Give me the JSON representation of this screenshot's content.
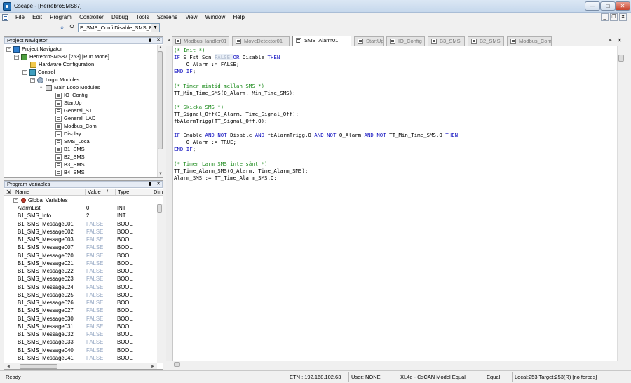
{
  "window": {
    "title": "Cscape - [HerrebroSMS87]",
    "minimize": "—",
    "maximize": "□",
    "close": "✕",
    "mdi_minimize": "_",
    "mdi_restore": "❐",
    "mdi_close": "✕"
  },
  "menu": {
    "items": [
      "File",
      "Edit",
      "Program",
      "Controller",
      "Debug",
      "Tools",
      "Screens",
      "View",
      "Window",
      "Help"
    ]
  },
  "toolbar": {
    "module_select": "E_SMS_Confi Disable_SMS_B1",
    "select_arrow": "▼"
  },
  "navigator": {
    "header": "Project Navigator",
    "pin": "▮",
    "close": "✕",
    "project": "Project Navigator",
    "controller": "HerrebroSMS87 [253] [Run Mode]",
    "hardware": "Hardware Configuration",
    "control": "Control",
    "logic_modules": "Logic Modules",
    "main_loop": "Main Loop Modules",
    "modules": [
      "IO_Config",
      "StartUp",
      "General_ST",
      "General_LAD",
      "Modbus_Com",
      "Display",
      "SMS_Local",
      "B1_SMS",
      "B2_SMS",
      "B3_SMS",
      "B4_SMS"
    ],
    "expand_minus": "−"
  },
  "variables": {
    "header": "Program Variables",
    "col_name": "Name",
    "col_value": "Value",
    "col_type": "Type",
    "col_dim": "Dim.",
    "sort_mark": "/",
    "group": "Global Variables",
    "rows": [
      {
        "name": "AlarmList",
        "value": "0",
        "type": "INT",
        "is_false": false
      },
      {
        "name": "B1_SMS_Info",
        "value": "2",
        "type": "INT",
        "is_false": false
      },
      {
        "name": "B1_SMS_Message001",
        "value": "FALSE",
        "type": "BOOL",
        "is_false": true
      },
      {
        "name": "B1_SMS_Message002",
        "value": "FALSE",
        "type": "BOOL",
        "is_false": true
      },
      {
        "name": "B1_SMS_Message003",
        "value": "FALSE",
        "type": "BOOL",
        "is_false": true
      },
      {
        "name": "B1_SMS_Message007",
        "value": "FALSE",
        "type": "BOOL",
        "is_false": true
      },
      {
        "name": "B1_SMS_Message020",
        "value": "FALSE",
        "type": "BOOL",
        "is_false": true
      },
      {
        "name": "B1_SMS_Message021",
        "value": "FALSE",
        "type": "BOOL",
        "is_false": true
      },
      {
        "name": "B1_SMS_Message022",
        "value": "FALSE",
        "type": "BOOL",
        "is_false": true
      },
      {
        "name": "B1_SMS_Message023",
        "value": "FALSE",
        "type": "BOOL",
        "is_false": true
      },
      {
        "name": "B1_SMS_Message024",
        "value": "FALSE",
        "type": "BOOL",
        "is_false": true
      },
      {
        "name": "B1_SMS_Message025",
        "value": "FALSE",
        "type": "BOOL",
        "is_false": true
      },
      {
        "name": "B1_SMS_Message026",
        "value": "FALSE",
        "type": "BOOL",
        "is_false": true
      },
      {
        "name": "B1_SMS_Message027",
        "value": "FALSE",
        "type": "BOOL",
        "is_false": true
      },
      {
        "name": "B1_SMS_Message030",
        "value": "FALSE",
        "type": "BOOL",
        "is_false": true
      },
      {
        "name": "B1_SMS_Message031",
        "value": "FALSE",
        "type": "BOOL",
        "is_false": true
      },
      {
        "name": "B1_SMS_Message032",
        "value": "FALSE",
        "type": "BOOL",
        "is_false": true
      },
      {
        "name": "B1_SMS_Message033",
        "value": "FALSE",
        "type": "BOOL",
        "is_false": true
      },
      {
        "name": "B1_SMS_Message040",
        "value": "FALSE",
        "type": "BOOL",
        "is_false": true
      },
      {
        "name": "B1_SMS_Message041",
        "value": "FALSE",
        "type": "BOOL",
        "is_false": true
      }
    ]
  },
  "tabs": [
    {
      "label": "ModbusHandler01",
      "active": false
    },
    {
      "label": "MoveDetector01",
      "active": false
    },
    {
      "label": "SMS_Alarm01",
      "active": true
    },
    {
      "label": "StartUp",
      "active": false
    },
    {
      "label": "IO_Config",
      "active": false
    },
    {
      "label": "B3_SMS",
      "active": false
    },
    {
      "label": "B2_SMS",
      "active": false
    },
    {
      "label": "Modbus_Com",
      "active": false
    }
  ],
  "tab_controls": {
    "left": "◄",
    "right": "►",
    "close": "✕"
  },
  "code": [
    [
      {
        "t": "(* Init *)",
        "c": "comment"
      }
    ],
    [
      {
        "t": "IF ",
        "c": "kw"
      },
      {
        "t": "S_Fst_Scn ",
        "c": ""
      },
      {
        "t": "FALSE ",
        "c": "greyed"
      },
      {
        "t": "OR ",
        "c": "kw"
      },
      {
        "t": "Disable ",
        "c": ""
      },
      {
        "t": "THEN",
        "c": "kw"
      }
    ],
    [
      {
        "t": "    O_Alarm := FALSE;",
        "c": ""
      }
    ],
    [
      {
        "t": "END_IF",
        "c": "kw"
      },
      {
        "t": ";",
        "c": ""
      }
    ],
    [],
    [
      {
        "t": "(* Timer mintid mellan SMS *)",
        "c": "comment"
      }
    ],
    [
      {
        "t": "TT_Min_Time_SMS(O_Alarm, Min_Time_SMS);",
        "c": ""
      }
    ],
    [],
    [
      {
        "t": "(* Skicka SMS *)",
        "c": "comment"
      }
    ],
    [
      {
        "t": "TT_Signal_Off(I_Alarm, Time_Signal_Off);",
        "c": ""
      }
    ],
    [
      {
        "t": "fbAlarmTrigg(TT_Signal_Off.Q);",
        "c": ""
      }
    ],
    [],
    [
      {
        "t": "IF ",
        "c": "kw"
      },
      {
        "t": "Enable ",
        "c": ""
      },
      {
        "t": "AND NOT ",
        "c": "kw"
      },
      {
        "t": "Disable ",
        "c": ""
      },
      {
        "t": "AND ",
        "c": "kw"
      },
      {
        "t": "fbAlarmTrigg.Q ",
        "c": ""
      },
      {
        "t": "AND NOT ",
        "c": "kw"
      },
      {
        "t": "O_Alarm ",
        "c": ""
      },
      {
        "t": "AND NOT ",
        "c": "kw"
      },
      {
        "t": "TT_Min_Time_SMS.Q ",
        "c": ""
      },
      {
        "t": "THEN",
        "c": "kw"
      }
    ],
    [
      {
        "t": "    O_Alarm := TRUE;",
        "c": ""
      }
    ],
    [
      {
        "t": "END_IF",
        "c": "kw"
      },
      {
        "t": ";",
        "c": ""
      }
    ],
    [],
    [
      {
        "t": "(* Timer Larm SMS inte sänt *)",
        "c": "comment"
      }
    ],
    [
      {
        "t": "TT_Time_Alarm_SMS(O_Alarm, Time_Alarm_SMS);",
        "c": ""
      }
    ],
    [
      {
        "t": "Alarm_SMS := TT_Time_Alarm_SMS.Q;",
        "c": ""
      }
    ]
  ],
  "status": {
    "ready": "Ready",
    "etn": "ETN : 192.168.102.63",
    "user": "User: NONE",
    "model": "XL4e - CsCAN Model Equal",
    "equal": "Equal",
    "target": "Local:253  Target:253(R) [no forces]"
  },
  "scroll": {
    "up": "▲",
    "down": "▼",
    "left": "◄",
    "right": "►"
  }
}
